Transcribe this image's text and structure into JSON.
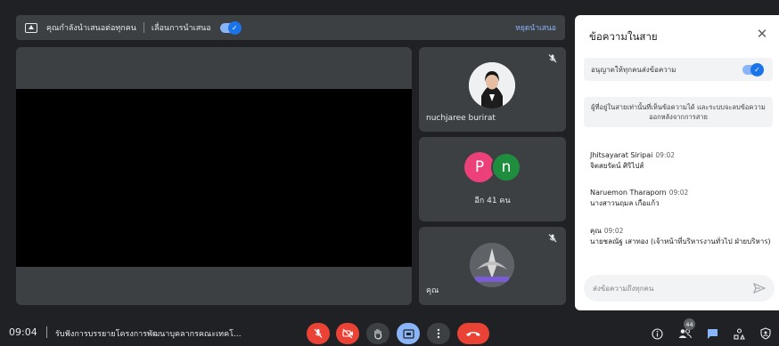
{
  "presenting_bar": {
    "status_text": "คุณกำลังนำเสนอต่อทุกคน",
    "follow_label": "เลื่อนการนำเสนอ",
    "follow_enabled": true,
    "stop_label": "หยุดนำเสนอ"
  },
  "tiles": [
    {
      "name": "nuchjaree burirat",
      "muted": true,
      "avatar": "profile-photo"
    },
    {
      "more_count_label": "อีก 41 คน",
      "avatars": [
        {
          "letter": "P",
          "color": "#ec407a"
        },
        {
          "letter": "n",
          "color": "#1e8e3e"
        }
      ]
    },
    {
      "name": "คุณ",
      "muted": true,
      "avatar": "organization-logo"
    }
  ],
  "chat": {
    "title": "ข้อความในสาย",
    "allow_label": "อนุญาตให้ทุกคนส่งข้อความ",
    "allow_enabled": true,
    "notice": "ผู้ที่อยู่ในสายเท่านั้นที่เห็นข้อความได้ และระบบจะลบข้อความออกหลังจากการสาย",
    "messages": [
      {
        "sender": "Jhitsayarat Siripai",
        "time": "09:02",
        "text": "จิตสยรัตน์ ศิริไปส์"
      },
      {
        "sender": "Naruemon Tharaporn",
        "time": "09:02",
        "text": "นางสาวนฤมล เกือแก้ว"
      },
      {
        "sender": "คุณ",
        "time": "09:02",
        "text": "นายชลณัฐ เสาทอง (เจ้าหน้าที่บริหารงานทั่วไป ฝ่ายบริหาร)"
      }
    ],
    "input_placeholder": "ส่งข้อความถึงทุกคน"
  },
  "bottom_bar": {
    "time": "09:04",
    "meeting_title": "รับฟังการบรรยายโครงการพัฒนาบุคลากรคณะเทคโ...",
    "participant_count": "44"
  },
  "colors": {
    "background": "#202124",
    "tile": "#3c4043",
    "accent": "#1a73e8",
    "danger": "#ea4335",
    "active": "#8ab4f8"
  },
  "icons": [
    "present-icon",
    "mic-off-icon",
    "camera-off-icon",
    "raise-hand-icon",
    "present-screen-icon",
    "more-vert-icon",
    "call-end-icon",
    "info-icon",
    "people-icon",
    "chat-icon",
    "activities-icon",
    "host-controls-icon",
    "close-icon",
    "send-icon"
  ]
}
